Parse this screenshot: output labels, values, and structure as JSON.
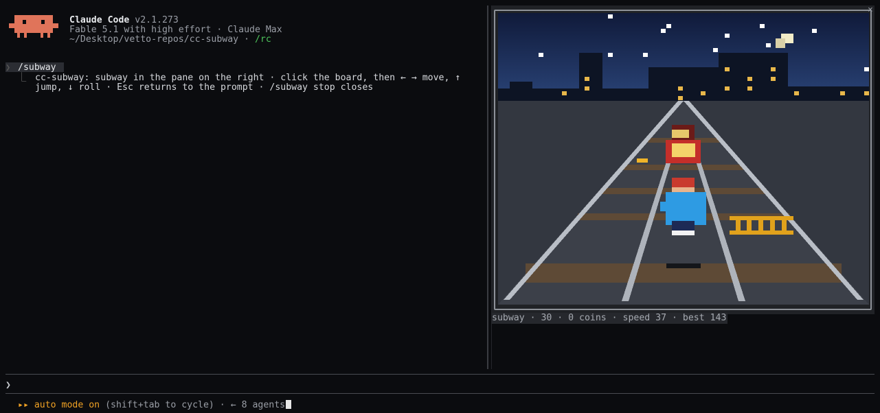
{
  "app": {
    "name": "Claude Code",
    "version": "v2.1.273",
    "model_line": "Fable 5.1 with high effort · Claude Max",
    "path": "~/Desktop/vetto-repos/cc-subway",
    "path_separator": " · ",
    "rc_link": "/rc"
  },
  "transcript": {
    "command": "/subway",
    "reply_line1": "cc-subway: subway in the pane on the right · click the board, then ← → move, ↑",
    "reply_line2": "jump, ↓ roll · Esc returns to the prompt · /subway stop closes"
  },
  "game": {
    "status": "subway · 30 · 0 coins · speed 37 · best 143",
    "close_glyph": "×",
    "colors": {
      "sky": "#1b2f5e",
      "track": "#3a3e47",
      "rail": "#b7bcc4",
      "tie": "#5c4a38",
      "player_shirt": "#2e9be3",
      "player_hair": "#c93a2e",
      "train": "#c42f2a",
      "barrier": "#e1a21c",
      "coin": "#f0b429"
    }
  },
  "prompt": {
    "caret": "❯",
    "value": "",
    "placeholder": ""
  },
  "footer": {
    "mode_icon": "▸▸",
    "mode_label": "auto mode on",
    "hint": "(shift+tab to cycle) · ← 8 agents"
  },
  "logo": {
    "color": "#e0745a",
    "icon": "crab-mascot-icon"
  }
}
